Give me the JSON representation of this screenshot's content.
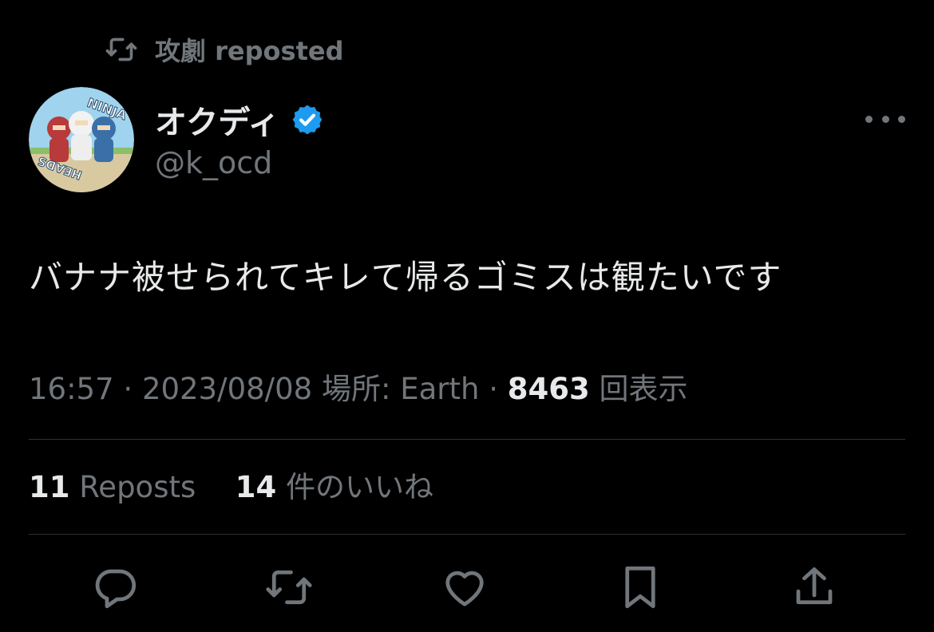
{
  "repost_header": {
    "icon": "repost-icon",
    "label": "攻劇 reposted"
  },
  "author": {
    "display_name": "オクディ",
    "handle": "@k_ocd",
    "verified": true,
    "avatar_text": [
      "NINJA",
      "HEADS"
    ]
  },
  "tweet": {
    "text": "バナナ被せられてキレて帰るゴミスは観たいです",
    "time": "16:57",
    "date": "2023/08/08",
    "location_label": "場所: Earth",
    "views": "8463",
    "views_label": "回表示"
  },
  "stats": {
    "reposts": "11",
    "reposts_label": "Reposts",
    "likes": "14",
    "likes_label": "件のいいね"
  },
  "actions": [
    {
      "icon": "reply-icon"
    },
    {
      "icon": "repost-icon"
    },
    {
      "icon": "like-icon"
    },
    {
      "icon": "bookmark-icon"
    },
    {
      "icon": "share-icon"
    }
  ],
  "colors": {
    "background": "#000000",
    "text": "#e7e9ea",
    "muted": "#71767b",
    "divider": "#2f3336",
    "verified": "#1d9bf0"
  }
}
